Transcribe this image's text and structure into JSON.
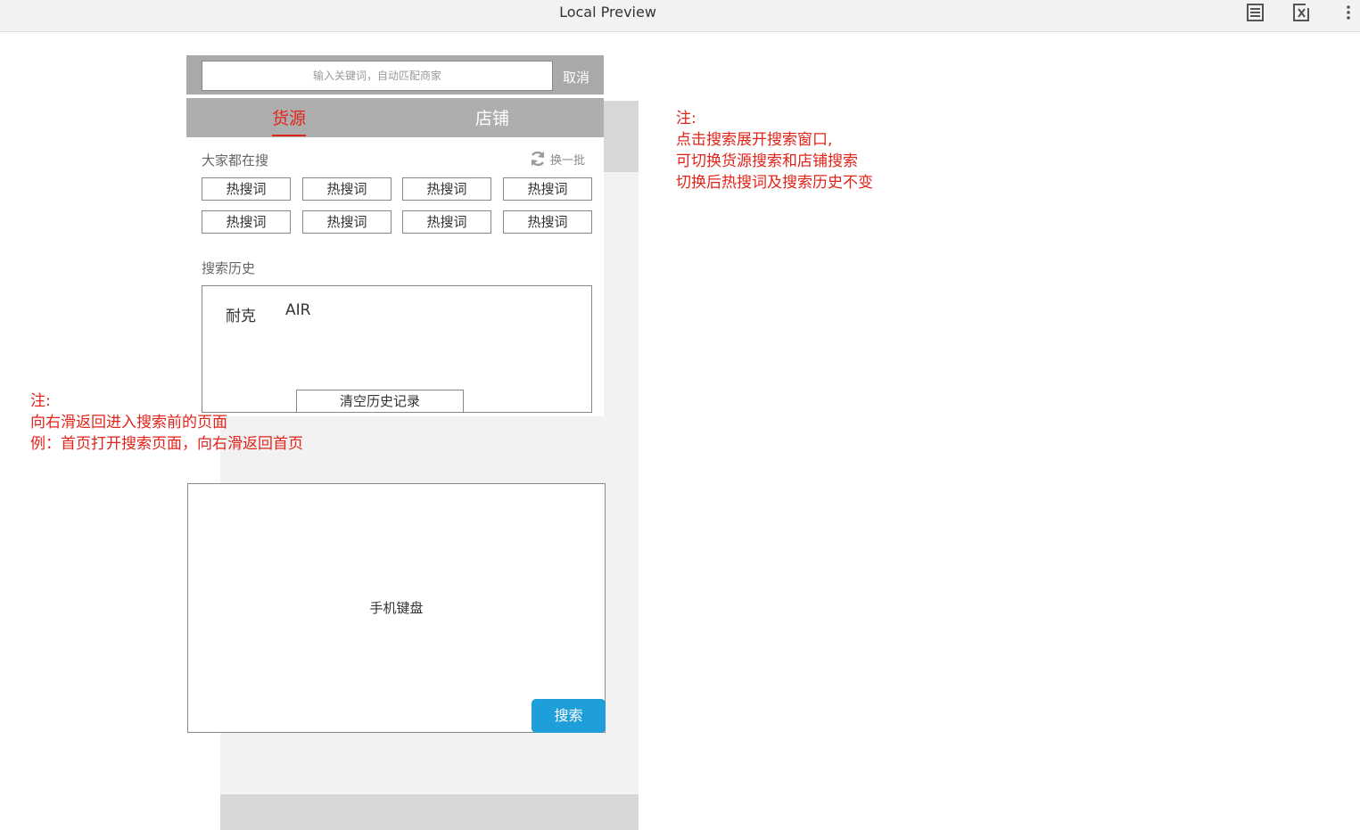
{
  "topbar": {
    "title": "Local Preview",
    "icons": [
      "document-icon",
      "close-variables-icon",
      "more-vertical-icon"
    ]
  },
  "search": {
    "placeholder": "输入关键词，自动匹配商家",
    "value": "",
    "cancel_label": "取消"
  },
  "tabs": [
    {
      "label": "货源",
      "active": true
    },
    {
      "label": "店铺",
      "active": false
    }
  ],
  "hot": {
    "title": "大家都在搜",
    "refresh_label": "换一批",
    "items": [
      "热搜词",
      "热搜词",
      "热搜词",
      "热搜词",
      "热搜词",
      "热搜词",
      "热搜词",
      "热搜词"
    ]
  },
  "history": {
    "title": "搜索历史",
    "items": [
      "耐克",
      "AIR"
    ],
    "clear_label": "清空历史记录"
  },
  "keyboard": {
    "label": "手机键盘",
    "search_label": "搜索"
  },
  "notes": {
    "right": [
      "注:",
      "点击搜索展开搜索窗口,",
      "可切换货源搜索和店铺搜索",
      "切换后热搜词及搜索历史不变"
    ],
    "left": [
      "注:",
      "向右滑返回进入搜索前的页面",
      "例：首页打开搜索页面，向右滑返回首页"
    ]
  },
  "colors": {
    "accent_red": "#e2231a",
    "search_blue": "#1e9fd9",
    "header_grey": "#aeaeae",
    "panel_grey": "#f2f2f2"
  }
}
